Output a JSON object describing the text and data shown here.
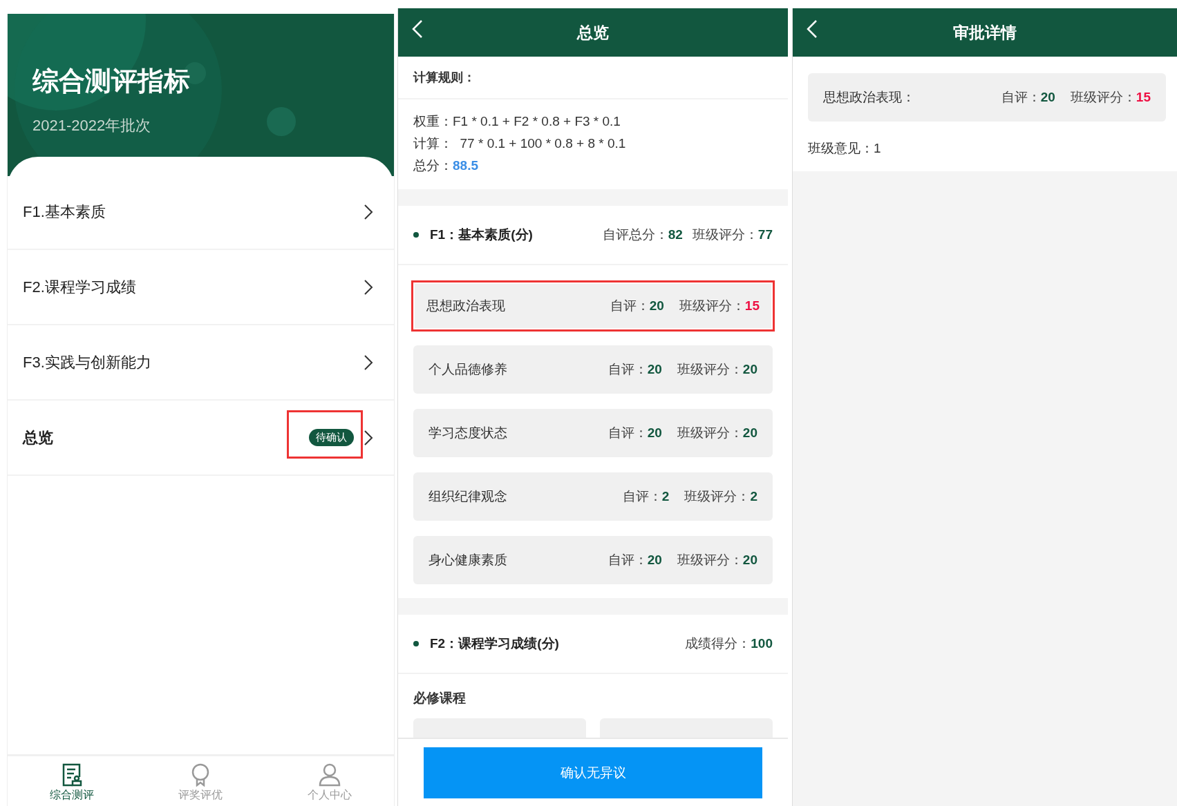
{
  "home": {
    "title": "综合测评指标",
    "subtitle": "2021-2022年批次",
    "items": [
      {
        "label": "F1.基本素质",
        "kind": "category",
        "highlighted": false
      },
      {
        "label": "F2.课程学习成绩",
        "kind": "category",
        "highlighted": false
      },
      {
        "label": "F3.实践与创新能力",
        "kind": "category",
        "highlighted": false
      },
      {
        "label": "总览",
        "kind": "summary",
        "badge": "待确认",
        "highlighted": true
      }
    ],
    "nav": [
      {
        "label": "综合测评",
        "selected": true
      },
      {
        "label": "评奖评优",
        "selected": false
      },
      {
        "label": "个人中心",
        "selected": false
      }
    ]
  },
  "overview": {
    "title": "总览",
    "rules_heading": "计算规则：",
    "rules": [
      "权重：F1 * 0.1 + F2 * 0.8 + F3 * 0.1",
      "计算：  77 * 0.1 + 100 * 0.8 + 8 * 0.1"
    ],
    "total_label": "总分：",
    "total": "88.5",
    "sections": [
      {
        "title": "F1：基本素质(分)",
        "stats": [
          {
            "label": "自评总分：",
            "value": "82"
          },
          {
            "label": "班级评分：",
            "value": "77"
          }
        ],
        "items": [
          {
            "name": "思想政治表现",
            "self_label": "自评：",
            "self": "20",
            "class_label": "班级评分：",
            "class": "15",
            "flagged": true,
            "highlighted": true
          },
          {
            "name": "个人品德修养",
            "self_label": "自评：",
            "self": "20",
            "class_label": "班级评分：",
            "class": "20",
            "flagged": false,
            "highlighted": false
          },
          {
            "name": "学习态度状态",
            "self_label": "自评：",
            "self": "20",
            "class_label": "班级评分：",
            "class": "20",
            "flagged": false,
            "highlighted": false
          },
          {
            "name": "组织纪律观念",
            "self_label": "自评：",
            "self": "2",
            "class_label": "班级评分：",
            "class": "2",
            "flagged": false,
            "highlighted": false
          },
          {
            "name": "身心健康素质",
            "self_label": "自评：",
            "self": "20",
            "class_label": "班级评分：",
            "class": "20",
            "flagged": false,
            "highlighted": false
          }
        ]
      },
      {
        "title": "F2：课程学习成绩(分)",
        "stats": [
          {
            "label": "成绩得分：",
            "value": "100"
          }
        ],
        "subheading": "必修课程"
      }
    ],
    "confirm_button": "确认无异议"
  },
  "detail": {
    "title": "审批详情",
    "item": {
      "name": "思想政治表现：",
      "self_label": "自评：",
      "self": "20",
      "class_label": "班级评分：",
      "class": "15",
      "flagged": true
    },
    "comment": "班级意见：1"
  }
}
